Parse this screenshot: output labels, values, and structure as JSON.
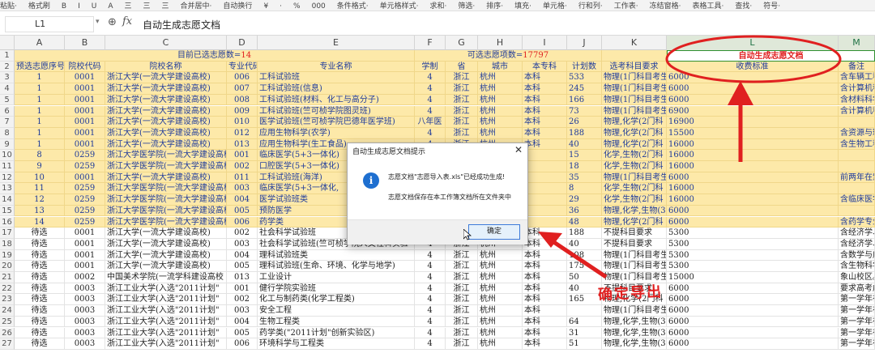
{
  "toolbar": {
    "items": [
      "粘贴·",
      "格式刷",
      "B",
      "I",
      "U",
      "A",
      "三",
      "三",
      "三",
      "合并居中·",
      "自动换行",
      "¥",
      "·",
      "%",
      "000",
      "条件格式·",
      "单元格样式·",
      "求和·",
      "筛选·",
      "排序·",
      "填充·",
      "单元格·",
      "行和列·",
      "工作表·",
      "冻结窗格·",
      "表格工具·",
      "查找·",
      "符号·"
    ]
  },
  "formula_bar": {
    "cell_ref": "L1",
    "dropdown_glyph": "▾",
    "zoom_glyph": "⊕",
    "fx_label": "fx",
    "value": "自动生成志愿文档"
  },
  "columns": [
    "A",
    "B",
    "C",
    "D",
    "E",
    "F",
    "G",
    "H",
    "I",
    "J",
    "K",
    "L",
    "M",
    "N"
  ],
  "row1": {
    "selected_label": "目前已选志愿数=",
    "selected_count": "14",
    "available_label": "可选志愿项数=",
    "available_count": "17797",
    "generate_label": "自动生成志愿文档"
  },
  "headers": [
    "预选志愿序号",
    "院校代码",
    "院校名称",
    "专业代码",
    "专业名称",
    "学制",
    "省",
    "城市",
    "本专科",
    "计划数",
    "选考科目要求",
    "收费标准",
    "备注"
  ],
  "rows": [
    {
      "n": "3",
      "y": true,
      "a": "1",
      "b": "0001",
      "c": "浙江大学(一流大学建设高校)",
      "d": "006",
      "e": "工科试验班",
      "f": "4",
      "g": "浙江",
      "h": "杭州",
      "i": "本科",
      "j": "533",
      "k": "物理(1门科目考生",
      "l": "6000",
      "m": "含车辆工程、能源与环境系统工程、机"
    },
    {
      "n": "4",
      "y": true,
      "a": "1",
      "b": "0001",
      "c": "浙江大学(一流大学建设高校)",
      "d": "007",
      "e": "工科试验班(信息)",
      "f": "4",
      "g": "浙江",
      "h": "杭州",
      "i": "本科",
      "j": "245",
      "k": "物理(1门科目考生",
      "l": "6000",
      "m": "含计算机科学与技术、信息安全、软件"
    },
    {
      "n": "5",
      "y": true,
      "a": "1",
      "b": "0001",
      "c": "浙江大学(一流大学建设高校)",
      "d": "008",
      "e": "工科试验班(材料、化工与高分子)",
      "f": "4",
      "g": "浙江",
      "h": "杭州",
      "i": "本科",
      "j": "166",
      "k": "物理(1门科目考生",
      "l": "6000",
      "m": "含材料科学与工程、化学工程与工艺、"
    },
    {
      "n": "6",
      "y": true,
      "a": "1",
      "b": "0001",
      "c": "浙江大学(一流大学建设高校)",
      "d": "009",
      "e": "工科试验班(竺可桢学院图灵班)",
      "f": "4",
      "g": "浙江",
      "h": "杭州",
      "i": "本科",
      "j": "73",
      "k": "物理(1门科目考生",
      "l": "6900",
      "m": "含计算机科学与技术、信息安全、人工"
    },
    {
      "n": "7",
      "y": true,
      "a": "1",
      "b": "0001",
      "c": "浙江大学(一流大学建设高校)",
      "d": "010",
      "e": "医学试验班(竺可桢学院巴德年医学班)",
      "f": "八年医",
      "g": "浙江",
      "h": "杭州",
      "i": "本科",
      "j": "26",
      "k": "物理,化学(2门科",
      "l": "16900",
      "m": ""
    },
    {
      "n": "8",
      "y": true,
      "a": "1",
      "b": "0001",
      "c": "浙江大学(一流大学建设高校)",
      "d": "012",
      "e": "应用生物科学(农学)",
      "f": "4",
      "g": "浙江",
      "h": "杭州",
      "i": "本科",
      "j": "188",
      "k": "物理,化学(2门科",
      "l": "15500",
      "m": "含资源与环境、茶学、农学、植物"
    },
    {
      "n": "9",
      "y": true,
      "a": "1",
      "b": "0001",
      "c": "浙江大学(一流大学建设高校)",
      "d": "013",
      "e": "应用生物科学(生工食品)",
      "f": "4",
      "g": "浙江",
      "h": "杭州",
      "i": "本科",
      "j": "40",
      "k": "物理,化学(2门科",
      "l": "16000",
      "m": "含生物工程、食品科学与工程专业。"
    },
    {
      "n": "10",
      "y": true,
      "a": "8",
      "b": "0259",
      "c": "浙江大学医学院(一流大学建设高校",
      "d": "001",
      "e": "临床医学(5+3一体化)",
      "f": "",
      "g": "",
      "h": "",
      "i": "",
      "j": "15",
      "k": "化学,生物(2门科",
      "l": "16000",
      "m": ""
    },
    {
      "n": "11",
      "y": true,
      "a": "9",
      "b": "0259",
      "c": "浙江大学医学院(一流大学建设高校",
      "d": "002",
      "e": "口腔医学(5+3一体化)",
      "f": "",
      "g": "",
      "h": "",
      "i": "",
      "j": "18",
      "k": "化学,生物(2门科",
      "l": "16000",
      "m": ""
    },
    {
      "n": "12",
      "y": true,
      "a": "10",
      "b": "0001",
      "c": "浙江大学(一流大学建设高校)",
      "d": "011",
      "e": "工科试验班(海洋)",
      "f": "",
      "g": "",
      "h": "",
      "i": "",
      "j": "35",
      "k": "物理(1门科目考生",
      "l": "6000",
      "m": "前两年在紫金港校区,后两年在舟山校"
    },
    {
      "n": "13",
      "y": true,
      "a": "11",
      "b": "0259",
      "c": "浙江大学医学院(一流大学建设高校",
      "d": "003",
      "e": "临床医学(5+3一体化,",
      "f": "",
      "g": "",
      "h": "",
      "i": "",
      "j": "8",
      "k": "化学,生物(2门科",
      "l": "16000",
      "m": ""
    },
    {
      "n": "14",
      "y": true,
      "a": "12",
      "b": "0259",
      "c": "浙江大学医学院(一流大学建设高校",
      "d": "004",
      "e": "医学试验班类",
      "f": "",
      "g": "",
      "h": "",
      "i": "",
      "j": "29",
      "k": "化学,生物(2门科",
      "l": "16000",
      "m": "含临床医学、口腔医学专业。"
    },
    {
      "n": "15",
      "y": true,
      "a": "13",
      "b": "0259",
      "c": "浙江大学医学院(一流大学建设高校",
      "d": "005",
      "e": "预防医学",
      "f": "",
      "g": "",
      "h": "",
      "i": "",
      "j": "36",
      "k": "物理,化学,生物(3",
      "l": "6000",
      "m": ""
    },
    {
      "n": "16",
      "y": true,
      "a": "14",
      "b": "0259",
      "c": "浙江大学医学院(一流大学建设高校",
      "d": "006",
      "e": "药学类",
      "f": "",
      "g": "",
      "h": "",
      "i": "",
      "j": "48",
      "k": "物理,化学(2门科",
      "l": "6000",
      "m": "含药学专业。"
    },
    {
      "n": "17",
      "y": false,
      "a": "待选",
      "b": "0001",
      "c": "浙江大学(一流大学建设高校)",
      "d": "002",
      "e": "社会科学试验班",
      "f": "4",
      "g": "浙江",
      "h": "杭州",
      "i": "本科",
      "j": "188",
      "k": "不提科目要求",
      "l": "5300",
      "m": "含经济学、财政学、金融学、国际经济"
    },
    {
      "n": "18",
      "y": false,
      "a": "待选",
      "b": "0001",
      "c": "浙江大学(一流大学建设高校)",
      "d": "003",
      "e": "社会科学试验班(竺可桢学院人文社科实验",
      "f": "4",
      "g": "浙江",
      "h": "杭州",
      "i": "本科",
      "j": "40",
      "k": "不提科目要求",
      "l": "5300",
      "m": "含经济学、财政学、金融学、国际经济"
    },
    {
      "n": "19",
      "y": false,
      "a": "待选",
      "b": "0001",
      "c": "浙江大学(一流大学建设高校)",
      "d": "004",
      "e": "理科试验班类",
      "f": "4",
      "g": "浙江",
      "h": "杭州",
      "i": "本科",
      "j": "108",
      "k": "物理(1门科目考生",
      "l": "5300",
      "m": "含数学与应用数学、信息与计算科学、"
    },
    {
      "n": "20",
      "y": false,
      "a": "待选",
      "b": "0001",
      "c": "浙江大学(一流大学建设高校)",
      "d": "005",
      "e": "理科试验班(生命、环境、化学与地学)",
      "f": "4",
      "g": "浙江",
      "h": "杭州",
      "i": "本科",
      "j": "175",
      "k": "物理(1门科目考生",
      "l": "5300",
      "m": "含生物科学、生态学、环境工程、环境"
    },
    {
      "n": "21",
      "y": false,
      "a": "待选",
      "b": "0002",
      "c": "中国美术学院(一流学科建设高校",
      "d": "013",
      "e": "工业设计",
      "f": "4",
      "g": "浙江",
      "h": "杭州",
      "i": "本科",
      "j": "50",
      "k": "物理(1门科目考生",
      "l": "15000",
      "m": "象山校区。"
    },
    {
      "n": "22",
      "y": false,
      "a": "待选",
      "b": "0003",
      "c": "浙江工业大学(入选\"2011计划\"",
      "d": "001",
      "e": "健行学院实验班",
      "f": "4",
      "g": "浙江",
      "h": "杭州",
      "i": "本科",
      "j": "40",
      "k": "不提科目要求",
      "l": "6000",
      "m": "要求高考成绩高出特殊类型招生控制线"
    },
    {
      "n": "23",
      "y": false,
      "a": "待选",
      "b": "0003",
      "c": "浙江工业大学(入选\"2011计划\"",
      "d": "002",
      "e": "化工与制药类(化学工程类)",
      "f": "4",
      "g": "浙江",
      "h": "杭州",
      "i": "本科",
      "j": "165",
      "k": "物理,化学(2门科",
      "l": "6000",
      "m": "第一学年在屏峰校区,第二学年起在莫"
    },
    {
      "n": "24",
      "y": false,
      "a": "待选",
      "b": "0003",
      "c": "浙江工业大学(入选\"2011计划\"",
      "d": "003",
      "e": "安全工程",
      "f": "4",
      "g": "浙江",
      "h": "杭州",
      "i": "本科",
      "j": "",
      "k": "物理(1门科目考生",
      "l": "6000",
      "m": "第一学年在屏峰校区,第二学年起在莫"
    },
    {
      "n": "25",
      "y": false,
      "a": "待选",
      "b": "0003",
      "c": "浙江工业大学(入选\"2011计划\"",
      "d": "004",
      "e": "生物工程类",
      "f": "4",
      "g": "浙江",
      "h": "杭州",
      "i": "本科",
      "j": "64",
      "k": "物理,化学,生物(3",
      "l": "6000",
      "m": "第一学年在屏峰校区,第二学年起在莫"
    },
    {
      "n": "26",
      "y": false,
      "a": "待选",
      "b": "0003",
      "c": "浙江工业大学(入选\"2011计划\"",
      "d": "005",
      "e": "药学类(\"2011计划\"创新实验区)",
      "f": "4",
      "g": "浙江",
      "h": "杭州",
      "i": "本科",
      "j": "31",
      "k": "物理,化学,生物(3",
      "l": "6000",
      "m": "第一学年在屏峰校区,第二学年起在莫"
    },
    {
      "n": "27",
      "y": false,
      "a": "待选",
      "b": "0003",
      "c": "浙江工业大学(入选\"2011计划\"",
      "d": "006",
      "e": "环境科学与工程类",
      "f": "4",
      "g": "浙江",
      "h": "杭州",
      "i": "本科",
      "j": "51",
      "k": "物理,化学,生物(3",
      "l": "6000",
      "m": "第一学年在屏峰校区,第二学年起在莫"
    }
  ],
  "dialog": {
    "title": "自动生成志愿文档提示",
    "close_glyph": "✕",
    "info_glyph": "i",
    "message1": "志愿文档\"志愿导入表.xls\"已经成功生成!",
    "message2": "志愿文档保存在本工作簿文档所在文件夹中",
    "ok_label": "确定"
  },
  "annotation": {
    "text": "确定导出",
    "color": "#e02020"
  }
}
